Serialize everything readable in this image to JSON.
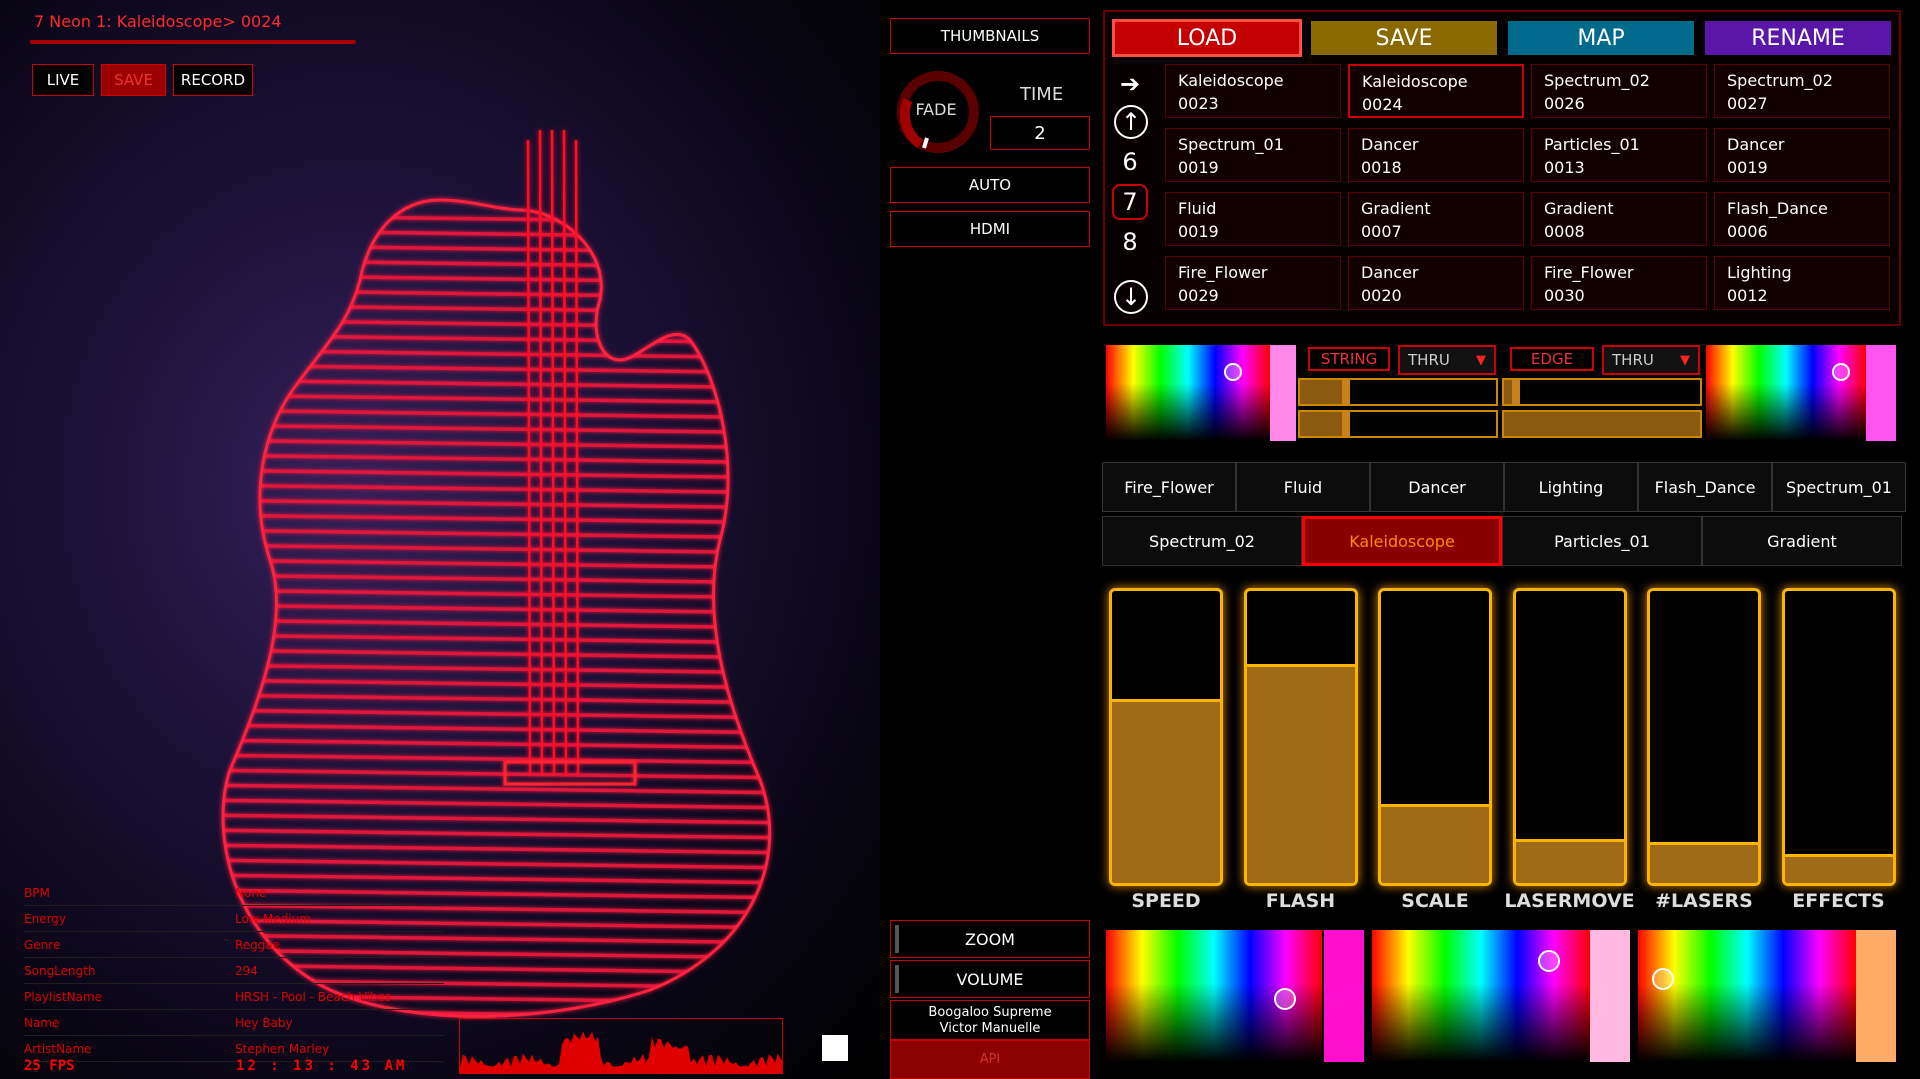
{
  "scene_title": "7 Neon 1: Kaleidoscope> 0024",
  "top_buttons": {
    "live": "LIVE",
    "save": "SAVE",
    "record": "RECORD"
  },
  "info": [
    {
      "key": "BPM",
      "value": "None"
    },
    {
      "key": "Energy",
      "value": "Low-Medium"
    },
    {
      "key": "Genre",
      "value": "Reggae"
    },
    {
      "key": "SongLength",
      "value": "294"
    },
    {
      "key": "PlaylistName",
      "value": "HRSH - Pool - Beach Vibes"
    },
    {
      "key": "Name",
      "value": "Hey Baby"
    },
    {
      "key": "ArtistName",
      "value": "Stephen Marley"
    }
  ],
  "fps": "25 FPS",
  "clock": "12 : 13 : 43 AM",
  "middle": {
    "thumbnails": "THUMBNAILS",
    "fade": "FADE",
    "time_label": "TIME",
    "time_value": "2",
    "auto": "AUTO",
    "hdmi": "HDMI",
    "zoom": "ZOOM",
    "volume": "VOLUME",
    "now_playing_line1": "Boogaloo Supreme",
    "now_playing_line2": "Victor Manuelle",
    "api": "API"
  },
  "header_buttons": {
    "load": "LOAD",
    "save": "SAVE",
    "map": "MAP",
    "rename": "RENAME"
  },
  "header_colors": {
    "load": "#c40000",
    "save": "#8a6a00",
    "map": "#006a8c",
    "rename": "#5a16a8"
  },
  "pages": {
    "prev": "6",
    "current": "7",
    "next": "8"
  },
  "nav_icons": [
    "arrow-right-icon",
    "arrow-up-icon",
    "arrow-down-icon"
  ],
  "grid": [
    [
      {
        "name": "Kaleidoscope",
        "num": "0023"
      },
      {
        "name": "Kaleidoscope",
        "num": "0024"
      },
      {
        "name": "Spectrum_02",
        "num": "0026"
      },
      {
        "name": "Spectrum_02",
        "num": "0027"
      }
    ],
    [
      {
        "name": "Spectrum_01",
        "num": "0019"
      },
      {
        "name": "Dancer",
        "num": "0018"
      },
      {
        "name": "Particles_01",
        "num": "0013"
      },
      {
        "name": "Dancer",
        "num": "0019"
      }
    ],
    [
      {
        "name": "Fluid",
        "num": "0019"
      },
      {
        "name": "Gradient",
        "num": "0007"
      },
      {
        "name": "Gradient",
        "num": "0008"
      },
      {
        "name": "Flash_Dance",
        "num": "0006"
      }
    ],
    [
      {
        "name": "Fire_Flower",
        "num": "0029"
      },
      {
        "name": "Dancer",
        "num": "0020"
      },
      {
        "name": "Fire_Flower",
        "num": "0030"
      },
      {
        "name": "Lighting",
        "num": "0012"
      }
    ]
  ],
  "color_mode": {
    "string": "STRING",
    "string_mode": "THRU",
    "edge": "EDGE",
    "edge_mode": "THRU"
  },
  "tabs_row1": [
    "Fire_Flower",
    "Fluid",
    "Dancer",
    "Lighting",
    "Flash_Dance",
    "Spectrum_01"
  ],
  "tabs_row2": [
    "Spectrum_02",
    "Kaleidoscope",
    "Particles_01",
    "Gradient"
  ],
  "selected_tab": "Kaleidoscope",
  "sliders": [
    {
      "label": "SPEED",
      "level": 0.62
    },
    {
      "label": "FLASH",
      "level": 0.74
    },
    {
      "label": "SCALE",
      "level": 0.26
    },
    {
      "label": "LASERMOVE",
      "level": 0.14
    },
    {
      "label": "#LASERS",
      "level": 0.13
    },
    {
      "label": "EFFECTS",
      "level": 0.09
    }
  ],
  "swatch_colors": {
    "top_left": "#ff88e8",
    "top_right": "#ff55ee",
    "bottom1": "#ff10d0",
    "bottom2": "#ffb8e0",
    "bottom3": "#ffaa66"
  }
}
